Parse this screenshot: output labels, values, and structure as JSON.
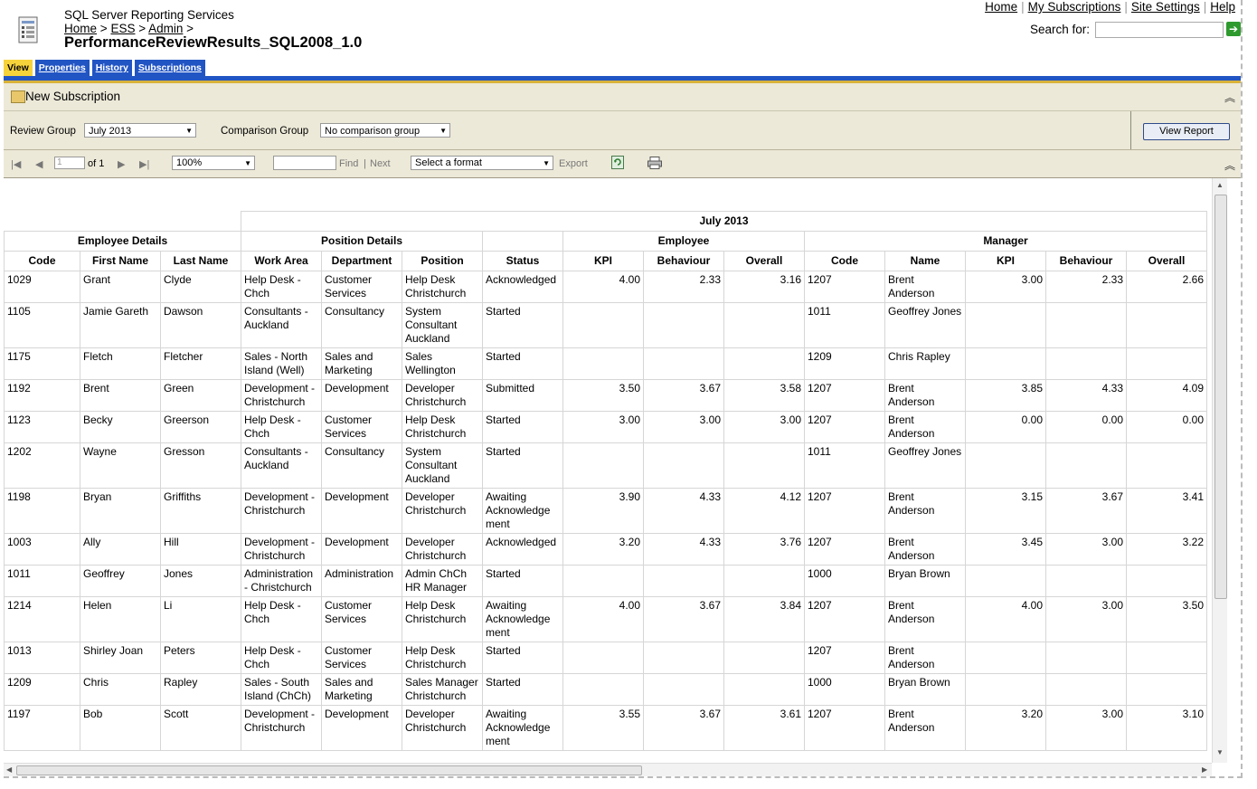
{
  "header": {
    "app_title": "SQL Server Reporting Services",
    "breadcrumb": [
      "Home",
      "ESS",
      "Admin"
    ],
    "breadcrumb_sep": ">",
    "report_title": "PerformanceReviewResults_SQL2008_1.0",
    "top_links": [
      "Home",
      "My Subscriptions",
      "Site Settings",
      "Help"
    ],
    "search_label": "Search for:",
    "search_value": ""
  },
  "tabs": [
    "View",
    "Properties",
    "History",
    "Subscriptions"
  ],
  "subscription_bar": {
    "label": "New Subscription"
  },
  "params": {
    "review_group_label": "Review Group",
    "review_group_value": "July 2013",
    "comparison_group_label": "Comparison Group",
    "comparison_group_value": "No comparison group",
    "view_report_label": "View Report"
  },
  "toolbar": {
    "page_value": "1",
    "page_of": "of 1",
    "zoom": "100%",
    "find_label": "Find",
    "find_sep": "|",
    "next_label": "Next",
    "format_placeholder": "Select a format",
    "export_label": "Export"
  },
  "report": {
    "period": "July 2013",
    "group_headers": {
      "employee_details": "Employee Details",
      "position_details": "Position Details",
      "employee": "Employee",
      "manager": "Manager"
    },
    "columns": [
      "Code",
      "First Name",
      "Last Name",
      "Work Area",
      "Department",
      "Position",
      "Status",
      "KPI",
      "Behaviour",
      "Overall",
      "Code",
      "Name",
      "KPI",
      "Behaviour",
      "Overall"
    ],
    "rows": [
      [
        "1029",
        "Grant",
        "Clyde",
        "Help Desk - Chch",
        "Customer Services",
        "Help Desk Christchurch",
        "Acknowledged",
        "4.00",
        "2.33",
        "3.16",
        "1207",
        "Brent Anderson",
        "3.00",
        "2.33",
        "2.66"
      ],
      [
        "1105",
        "Jamie Gareth",
        "Dawson",
        "Consultants - Auckland",
        "Consultancy",
        "System Consultant Auckland",
        "Started",
        "",
        "",
        "",
        "1011",
        "Geoffrey Jones",
        "",
        "",
        ""
      ],
      [
        "1175",
        "Fletch",
        "Fletcher",
        "Sales - North Island (Well)",
        "Sales and Marketing",
        "Sales Wellington",
        "Started",
        "",
        "",
        "",
        "1209",
        "Chris Rapley",
        "",
        "",
        ""
      ],
      [
        "1192",
        "Brent",
        "Green",
        "Development - Christchurch",
        "Development",
        "Developer Christchurch",
        "Submitted",
        "3.50",
        "3.67",
        "3.58",
        "1207",
        "Brent Anderson",
        "3.85",
        "4.33",
        "4.09"
      ],
      [
        "1123",
        "Becky",
        "Greerson",
        "Help Desk - Chch",
        "Customer Services",
        "Help Desk Christchurch",
        "Started",
        "3.00",
        "3.00",
        "3.00",
        "1207",
        "Brent Anderson",
        "0.00",
        "0.00",
        "0.00"
      ],
      [
        "1202",
        "Wayne",
        "Gresson",
        "Consultants - Auckland",
        "Consultancy",
        "System Consultant Auckland",
        "Started",
        "",
        "",
        "",
        "1011",
        "Geoffrey Jones",
        "",
        "",
        ""
      ],
      [
        "1198",
        "Bryan",
        "Griffiths",
        "Development - Christchurch",
        "Development",
        "Developer Christchurch",
        "Awaiting Acknowledge ment",
        "3.90",
        "4.33",
        "4.12",
        "1207",
        "Brent Anderson",
        "3.15",
        "3.67",
        "3.41"
      ],
      [
        "1003",
        "Ally",
        "Hill",
        "Development - Christchurch",
        "Development",
        "Developer Christchurch",
        "Acknowledged",
        "3.20",
        "4.33",
        "3.76",
        "1207",
        "Brent Anderson",
        "3.45",
        "3.00",
        "3.22"
      ],
      [
        "1011",
        "Geoffrey",
        "Jones",
        "Administration - Christchurch",
        "Administration",
        "Admin ChCh HR Manager",
        "Started",
        "",
        "",
        "",
        "1000",
        "Bryan Brown",
        "",
        "",
        ""
      ],
      [
        "1214",
        "Helen",
        "Li",
        "Help Desk - Chch",
        "Customer Services",
        "Help Desk Christchurch",
        "Awaiting Acknowledge ment",
        "4.00",
        "3.67",
        "3.84",
        "1207",
        "Brent Anderson",
        "4.00",
        "3.00",
        "3.50"
      ],
      [
        "1013",
        "Shirley Joan",
        "Peters",
        "Help Desk - Chch",
        "Customer Services",
        "Help Desk Christchurch",
        "Started",
        "",
        "",
        "",
        "1207",
        "Brent Anderson",
        "",
        "",
        ""
      ],
      [
        "1209",
        "Chris",
        "Rapley",
        "Sales - South Island (ChCh)",
        "Sales and Marketing",
        "Sales Manager Christchurch",
        "Started",
        "",
        "",
        "",
        "1000",
        "Bryan Brown",
        "",
        "",
        ""
      ],
      [
        "1197",
        "Bob",
        "Scott",
        "Development - Christchurch",
        "Development",
        "Developer Christchurch",
        "Awaiting Acknowledge ment",
        "3.55",
        "3.67",
        "3.61",
        "1207",
        "Brent Anderson",
        "3.20",
        "3.00",
        "3.10"
      ]
    ]
  }
}
